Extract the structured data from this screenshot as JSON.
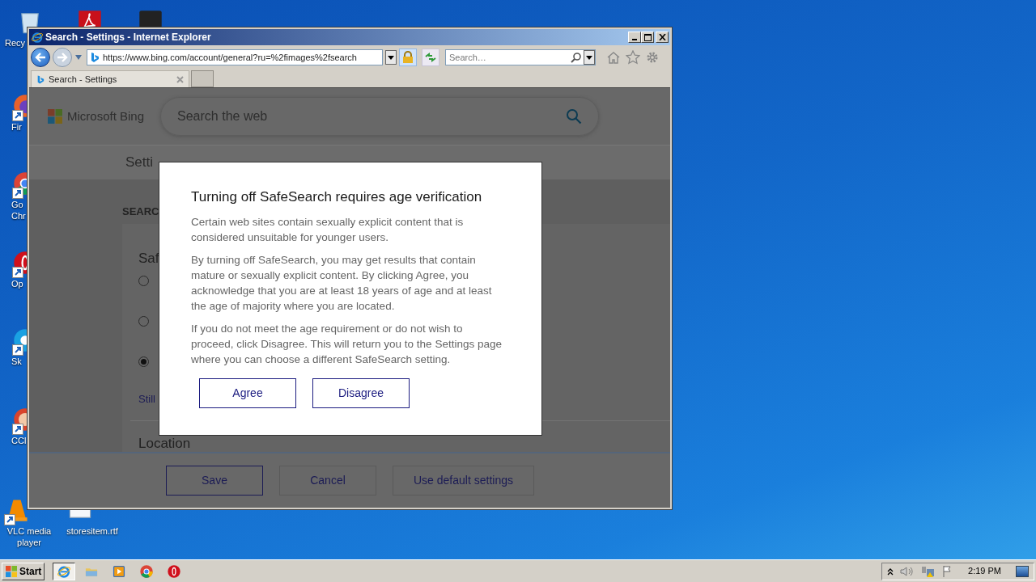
{
  "desktop_icons": [
    {
      "kind": "recycle",
      "lines": [
        "Recy"
      ]
    },
    {
      "kind": "acrobat"
    },
    {
      "kind": "dark"
    },
    {
      "kind": "firefox",
      "lines": [
        "Fir"
      ]
    },
    {
      "kind": "chrome",
      "lines": [
        "Go",
        "Chr"
      ]
    },
    {
      "kind": "opera",
      "lines": [
        "Op"
      ]
    },
    {
      "kind": "skype",
      "lines": [
        "Sk"
      ]
    },
    {
      "kind": "ccleaner",
      "lines": [
        "CCl"
      ]
    },
    {
      "kind": "vlc",
      "lines": [
        "VLC media",
        "player"
      ]
    },
    {
      "kind": "document",
      "lines": [
        "storesitem.rtf"
      ]
    }
  ],
  "window": {
    "title": "Search - Settings - Internet Explorer"
  },
  "address_bar": {
    "url": "https://www.bing.com/account/general?ru=%2fimages%2fsearch"
  },
  "search_field": {
    "placeholder": "Search…"
  },
  "tabs": [
    {
      "label": "Search - Settings",
      "selected": true
    }
  ],
  "page": {
    "logo": "Microsoft Bing",
    "search_placeholder": "Search the web",
    "heading": "Setti",
    "section": "SEARC",
    "group_title": "Saf",
    "radios": [
      {
        "selected": false
      },
      {
        "selected": false
      },
      {
        "selected": true
      }
    ],
    "link": "Still",
    "location": "Location",
    "buttons": [
      {
        "label": "Save",
        "primary": true
      },
      {
        "label": "Cancel",
        "primary": false
      },
      {
        "label": "Use default settings",
        "primary": false
      }
    ]
  },
  "dialog": {
    "title": "Turning off SafeSearch requires age verification",
    "paragraphs": [
      "Certain web sites contain sexually explicit content that is considered unsuitable for younger users.",
      "By turning off SafeSearch, you may get results that contain mature or sexually explicit content. By clicking Agree, you acknowledge that you are at least 18 years of age and at least the age of majority where you are located.",
      "If you do not meet the age requirement or do not wish to proceed, click Disagree. This will return you to the Settings page where you can choose a different SafeSearch setting."
    ],
    "buttons": [
      "Agree",
      "Disagree"
    ]
  },
  "taskbar": {
    "start": "Start",
    "apps": [
      {
        "kind": "ie",
        "selected": true
      },
      {
        "kind": "folder",
        "selected": false
      },
      {
        "kind": "media",
        "selected": false
      },
      {
        "kind": "chrome",
        "selected": false
      },
      {
        "kind": "opera",
        "selected": false
      }
    ],
    "clock": "2:19 PM"
  }
}
